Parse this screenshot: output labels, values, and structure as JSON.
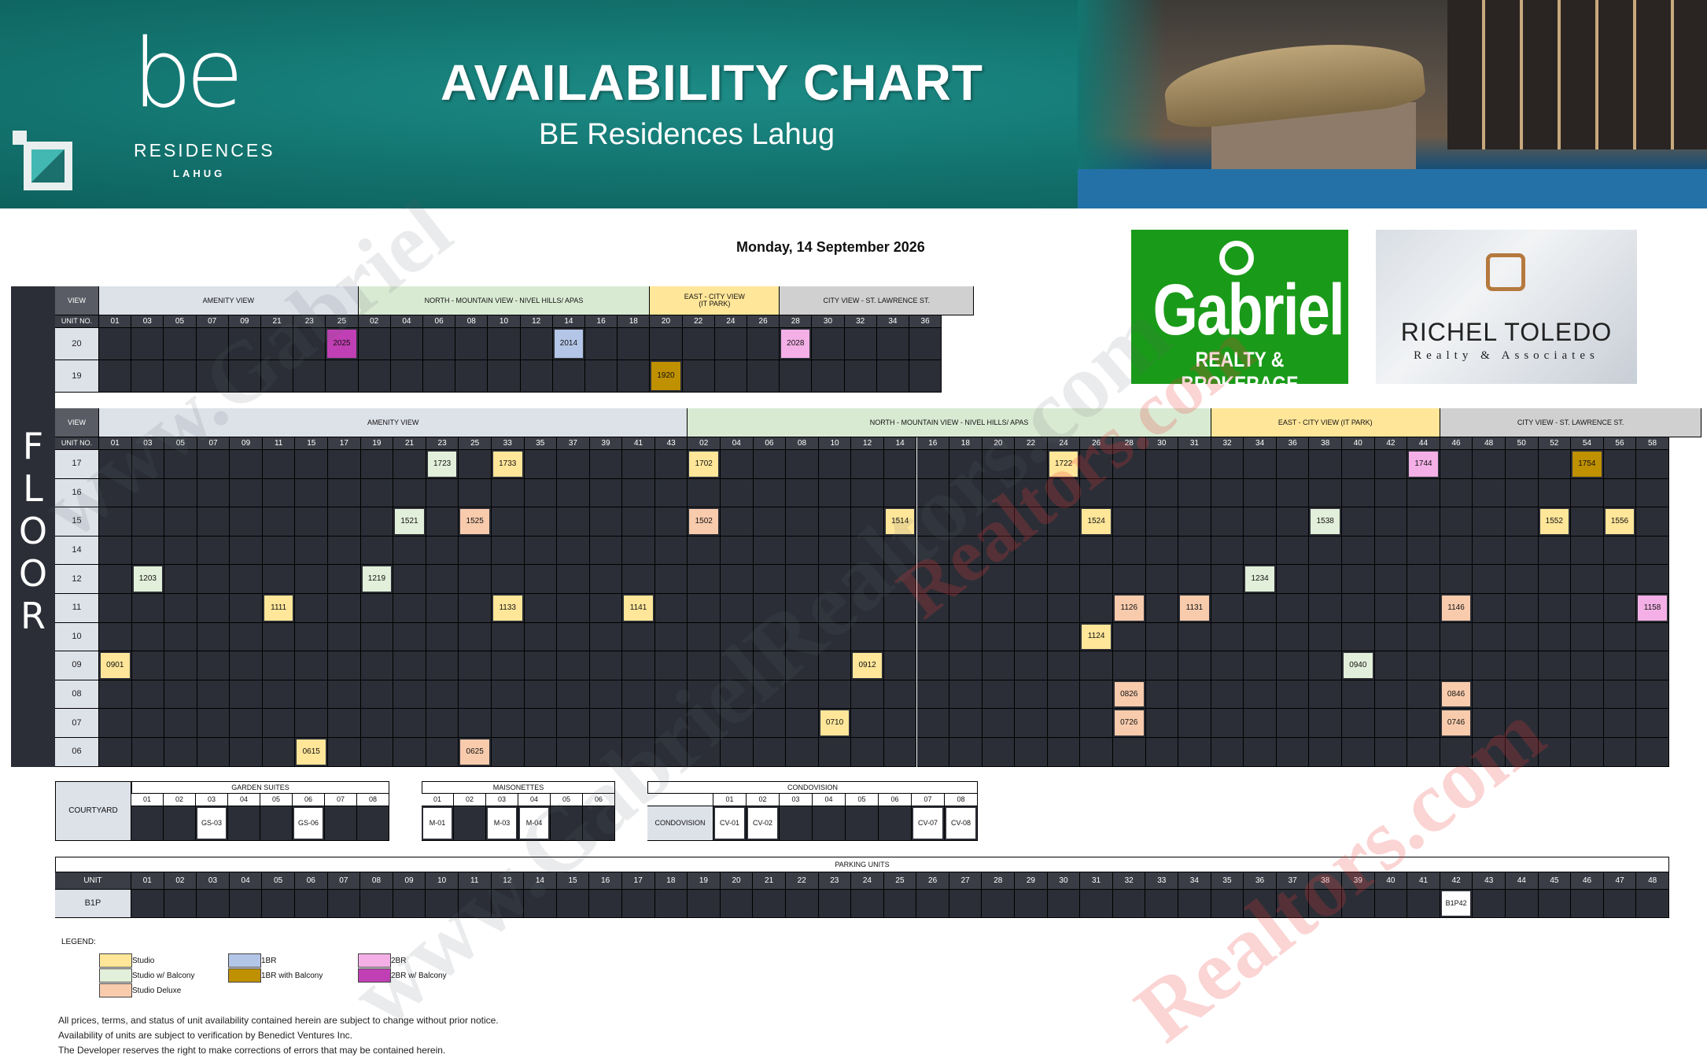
{
  "banner": {
    "logo_mark": "be",
    "logo_residences": "RESIDENCES",
    "logo_lahug": "LAHUG",
    "title": "AVAILABILITY CHART",
    "subtitle": "BE Residences Lahug"
  },
  "date": "Monday, 14 September 2026",
  "brands": {
    "gabriel_name": "Gabriel",
    "gabriel_sub": "REALTY & BROKERAGE",
    "richel_name": "RICHEL TOLEDO",
    "richel_sub": "Realty & Associates"
  },
  "floor_word": [
    "F",
    "L",
    "O",
    "O",
    "R"
  ],
  "labels": {
    "view": "VIEW",
    "unit_no": "UNIT NO."
  },
  "top_table": {
    "views": [
      {
        "label": "AMENITY VIEW",
        "span": 8,
        "color": "#dde1e8"
      },
      {
        "label": "NORTH - MOUNTAIN VIEW - NIVEL HILLS/ APAS",
        "span": 9,
        "color": "#d9ead3"
      },
      {
        "label": "EAST - CITY VIEW\n(IT PARK)",
        "span": 4,
        "color": "#ffe699"
      },
      {
        "label": "CITY VIEW - ST. LAWRENCE ST.",
        "span": 6,
        "color": "#d0d0d0"
      }
    ],
    "units": [
      "01",
      "03",
      "05",
      "07",
      "09",
      "21",
      "23",
      "25",
      "02",
      "04",
      "06",
      "08",
      "10",
      "12",
      "14",
      "16",
      "18",
      "20",
      "22",
      "24",
      "26",
      "28",
      "30",
      "32",
      "34",
      "36"
    ],
    "floors": [
      {
        "floor": "20",
        "cells": {
          "7": [
            "2025",
            "2br_balcony"
          ],
          "14": [
            "2014",
            "1br"
          ],
          "21": [
            "2028",
            "2br"
          ]
        }
      },
      {
        "floor": "19",
        "cells": {
          "17": [
            "1920",
            "1br_balcony"
          ]
        }
      }
    ]
  },
  "main_table": {
    "views": [
      {
        "label": "AMENITY VIEW",
        "span": 18,
        "color": "#dde1e8"
      },
      {
        "label": "NORTH - MOUNTAIN VIEW - NIVEL HILLS/ APAS",
        "span": 16,
        "color": "#d9ead3"
      },
      {
        "label": "EAST - CITY VIEW (IT PARK)",
        "span": 7,
        "color": "#ffe699"
      },
      {
        "label": "CITY VIEW - ST. LAWRENCE ST.",
        "span": 8,
        "color": "#d0d0d0"
      }
    ],
    "units": [
      "01",
      "03",
      "05",
      "07",
      "09",
      "11",
      "15",
      "17",
      "19",
      "21",
      "23",
      "25",
      "33",
      "35",
      "37",
      "39",
      "41",
      "43",
      "02",
      "04",
      "06",
      "08",
      "10",
      "12",
      "14",
      "16",
      "18",
      "20",
      "22",
      "24",
      "26",
      "28",
      "30",
      "31",
      "32",
      "34",
      "36",
      "38",
      "40",
      "42",
      "44",
      "46",
      "48",
      "50",
      "52",
      "54",
      "56",
      "58"
    ],
    "floors": [
      {
        "floor": "17",
        "cells": {
          "10": [
            "1723",
            "studio_balcony"
          ],
          "12": [
            "1733",
            "studio"
          ],
          "18": [
            "1702",
            "studio"
          ],
          "29": [
            "1722",
            "studio"
          ],
          "40": [
            "1744",
            "2br"
          ],
          "45": [
            "1754",
            "1br_balcony"
          ]
        }
      },
      {
        "floor": "16",
        "cells": {}
      },
      {
        "floor": "15",
        "cells": {
          "9": [
            "1521",
            "studio_balcony"
          ],
          "11": [
            "1525",
            "studio_deluxe"
          ],
          "18": [
            "1502",
            "studio_deluxe"
          ],
          "24": [
            "1514",
            "studio"
          ],
          "30": [
            "1524",
            "studio"
          ],
          "37": [
            "1538",
            "studio_balcony"
          ],
          "44": [
            "1552",
            "studio"
          ],
          "46": [
            "1556",
            "studio"
          ]
        }
      },
      {
        "floor": "14",
        "cells": {}
      },
      {
        "floor": "12",
        "cells": {
          "1": [
            "1203",
            "studio_balcony"
          ],
          "8": [
            "1219",
            "studio_balcony"
          ],
          "35": [
            "1234",
            "studio_balcony"
          ]
        }
      },
      {
        "floor": "11",
        "cells": {
          "5": [
            "1111",
            "studio"
          ],
          "12": [
            "1133",
            "studio"
          ],
          "16": [
            "1141",
            "studio"
          ],
          "31": [
            "1126",
            "studio_deluxe"
          ],
          "33": [
            "1131",
            "studio_deluxe"
          ],
          "41": [
            "1146",
            "studio_deluxe"
          ],
          "47": [
            "1158",
            "2br"
          ]
        }
      },
      {
        "floor": "10",
        "cells": {
          "30": [
            "1124",
            "studio"
          ]
        }
      },
      {
        "floor": "09",
        "cells": {
          "0": [
            "0901",
            "studio"
          ],
          "23": [
            "0912",
            "studio"
          ],
          "38": [
            "0940",
            "studio_balcony"
          ]
        }
      },
      {
        "floor": "08",
        "cells": {
          "31": [
            "0826",
            "studio_deluxe"
          ],
          "41": [
            "0846",
            "studio_deluxe"
          ]
        }
      },
      {
        "floor": "07",
        "cells": {
          "22": [
            "0710",
            "studio"
          ],
          "31": [
            "0726",
            "studio_deluxe"
          ],
          "41": [
            "0746",
            "studio_deluxe"
          ]
        }
      },
      {
        "floor": "06",
        "cells": {
          "6": [
            "0615",
            "studio"
          ],
          "11": [
            "0625",
            "studio_deluxe"
          ]
        }
      }
    ]
  },
  "courtyard": {
    "label": "COURTYARD",
    "title": "GARDEN SUITES",
    "units": [
      "01",
      "02",
      "03",
      "04",
      "05",
      "06",
      "07",
      "08"
    ],
    "values": [
      "",
      "",
      "GS-03",
      "",
      "",
      "GS-06",
      "",
      ""
    ]
  },
  "maisonettes": {
    "title": "MAISONETTES",
    "units": [
      "01",
      "02",
      "03",
      "04",
      "05",
      "06"
    ],
    "values": [
      "M-01",
      "",
      "M-03",
      "M-04",
      "",
      ""
    ]
  },
  "condovision": {
    "title": "CONDOVISION",
    "label": "CONDOVISION",
    "units": [
      "01",
      "02",
      "03",
      "04",
      "05",
      "06",
      "07",
      "08"
    ],
    "values": [
      "CV-01",
      "CV-02",
      "",
      "",
      "",
      "",
      "CV-07",
      "CV-08"
    ]
  },
  "parking": {
    "title": "PARKING UNITS",
    "unit_label": "UNIT",
    "row_label": "B1P",
    "units": [
      "01",
      "02",
      "03",
      "04",
      "05",
      "06",
      "07",
      "08",
      "09",
      "10",
      "11",
      "12",
      "14",
      "15",
      "16",
      "17",
      "18",
      "19",
      "20",
      "21",
      "22",
      "23",
      "24",
      "25",
      "26",
      "27",
      "28",
      "29",
      "30",
      "31",
      "32",
      "33",
      "34",
      "35",
      "36",
      "37",
      "38",
      "39",
      "40",
      "41",
      "42",
      "43",
      "44",
      "45",
      "46",
      "47",
      "48"
    ],
    "values": {
      "40": "B1P42"
    }
  },
  "legend": {
    "title": "LEGEND:",
    "items": [
      {
        "key": "studio",
        "label": "Studio",
        "color": "#ffe699"
      },
      {
        "key": "studio_balcony",
        "label": "Studio w/ Balcony",
        "color": "#e2efda"
      },
      {
        "key": "studio_deluxe",
        "label": "Studio Deluxe",
        "color": "#f8cbad"
      },
      {
        "key": "1br",
        "label": "1BR",
        "color": "#b4c6e7"
      },
      {
        "key": "1br_balcony",
        "label": "1BR with Balcony",
        "color": "#bf9000"
      },
      {
        "key": "2br",
        "label": "2BR",
        "color": "#f4b0e6"
      },
      {
        "key": "2br_balcony",
        "label": "2BR w/ Balcony",
        "color": "#c13fb4"
      }
    ]
  },
  "notes": [
    "All prices, terms, and status of unit availability contained herein are subject to change without prior notice.",
    "Availability of units are subject to verification by Benedict Ventures Inc.",
    "The Developer reserves the right to make corrections of errors that may be contained herein."
  ],
  "watermarks": [
    "www.Gabriel",
    "www.GabrielRealtors.com",
    "Realtors.com"
  ]
}
